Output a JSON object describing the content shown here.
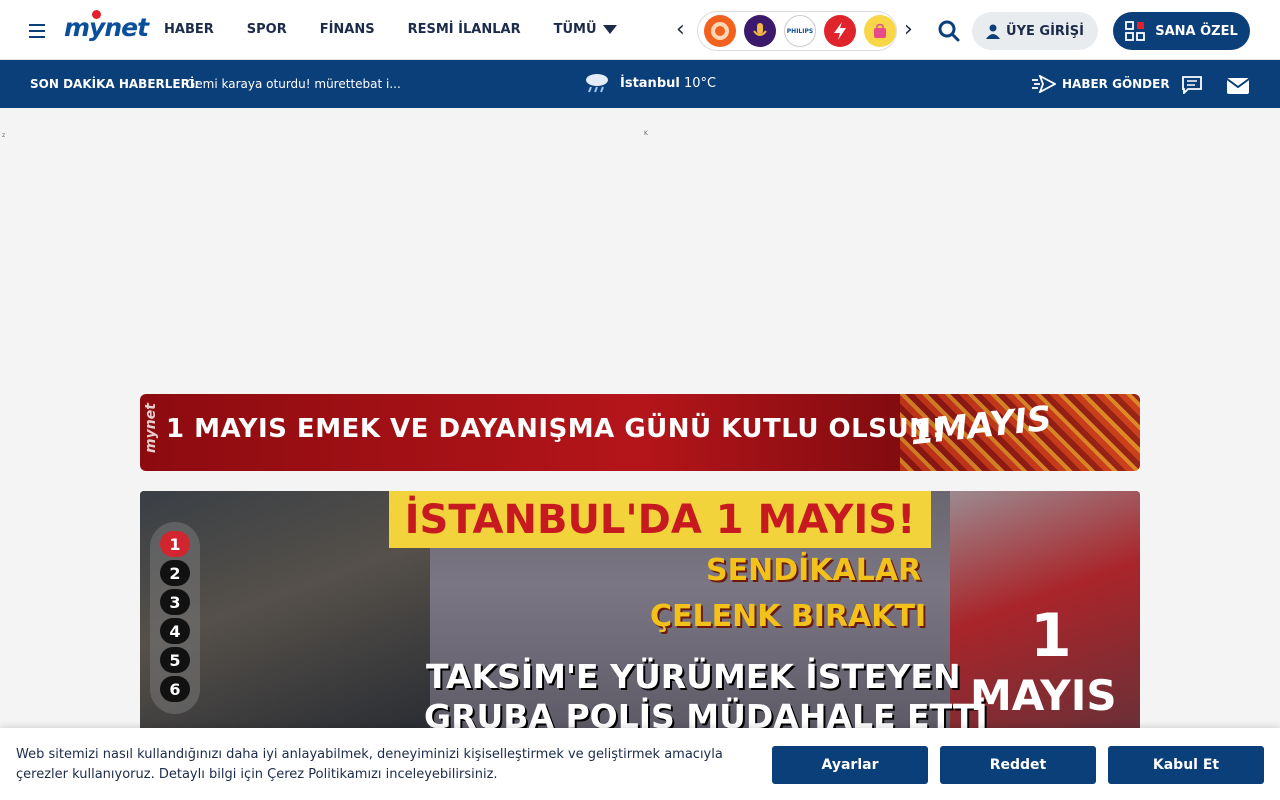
{
  "header": {
    "logo_text": "mynet",
    "nav": [
      {
        "label": "HABER"
      },
      {
        "label": "SPOR"
      },
      {
        "label": "FİNANS"
      },
      {
        "label": "RESMİ İLANLAR"
      },
      {
        "label": "TÜMÜ"
      }
    ],
    "brands": [
      {
        "icon": "lion-icon",
        "color": "#f2611d"
      },
      {
        "icon": "microphone-icon",
        "color": "#3b1a6b"
      },
      {
        "icon": "philips-logo",
        "color": "#ffffff",
        "text": "PHILIPS"
      },
      {
        "icon": "lightning-icon",
        "color": "#e0242b"
      },
      {
        "icon": "shopping-bag-icon",
        "color": "#f7d648"
      }
    ],
    "login_label": "ÜYE GİRİŞİ",
    "special_label": "SANA ÖZEL"
  },
  "newsbar": {
    "breaking_label": "SON DAKİKA HABERLERİ:",
    "breaking_text": "Gemi karaya oturdu! mürettebat i...",
    "weather_city": "İstanbul",
    "weather_temp": "10°C",
    "send_news_label": "HABER GÖNDER"
  },
  "ad": {
    "mark_left": "z",
    "mark_center": "K"
  },
  "may_banner": {
    "logo_text": "mynet",
    "text": "1 MAYIS EMEK VE DAYANIŞMA GÜNÜ KUTLU OLSUN!",
    "logo_mark": "1MAYIS"
  },
  "hero": {
    "title": "İSTANBUL'DA 1 MAYIS!",
    "line1": "SENDİKALAR",
    "line2": "ÇELENK BIRAKTI",
    "line3": "TAKSİM'E YÜRÜMEK İSTEYEN",
    "line4": "GRUBA POLİS MÜDAHALE ETTİ",
    "sign": "MAYIS",
    "sign_number": "1",
    "pages": [
      "1",
      "2",
      "3",
      "4",
      "5",
      "6"
    ],
    "active_page": 1
  },
  "cookie": {
    "text": "Web sitemizi nasıl kullandığınızı daha iyi anlayabilmek, deneyiminizi kişiselleştirmek ve geliştirmek amacıyla çerezler kullanıyoruz. Detaylı bilgi için Çerez Politikamızı inceleyebilirsiniz.",
    "settings_label": "Ayarlar",
    "reject_label": "Reddet",
    "accept_label": "Kabul Et"
  },
  "colors": {
    "brand_blue": "#0b3f7a",
    "accent_red": "#d1262f"
  }
}
